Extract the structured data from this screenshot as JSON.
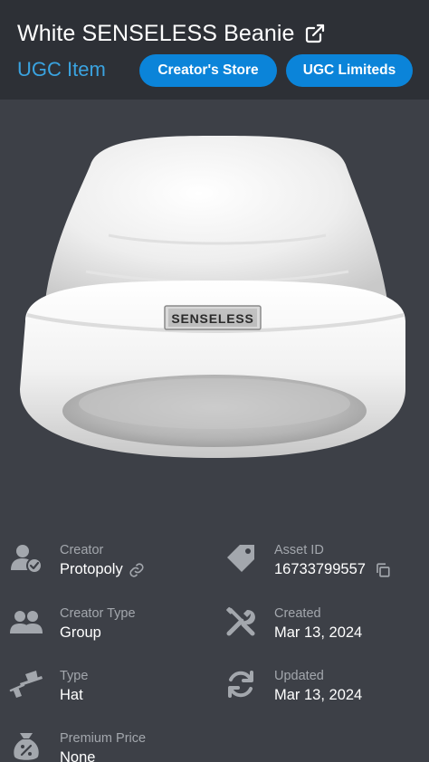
{
  "header": {
    "title": "White SENSELESS Beanie",
    "subtitle": "UGC Item",
    "buttons": {
      "creators_store": "Creator's Store",
      "ugc_limiteds": "UGC Limiteds"
    },
    "accent_color": "#3aa3e0",
    "button_color": "#0b84d9"
  },
  "hero": {
    "label_text": "SENSELESS"
  },
  "details": {
    "creator": {
      "label": "Creator",
      "value": "Protopoly",
      "icon": "user-verified-icon"
    },
    "asset_id": {
      "label": "Asset ID",
      "value": "16733799557",
      "icon": "tag-icon"
    },
    "creator_type": {
      "label": "Creator Type",
      "value": "Group",
      "icon": "group-icon"
    },
    "created": {
      "label": "Created",
      "value": "Mar 13, 2024",
      "icon": "tools-icon"
    },
    "type": {
      "label": "Type",
      "value": "Hat",
      "icon": "hat-icon"
    },
    "updated": {
      "label": "Updated",
      "value": "Mar 13, 2024",
      "icon": "refresh-icon"
    },
    "premium_price": {
      "label": "Premium Price",
      "value": "None",
      "icon": "money-bag-icon"
    }
  }
}
